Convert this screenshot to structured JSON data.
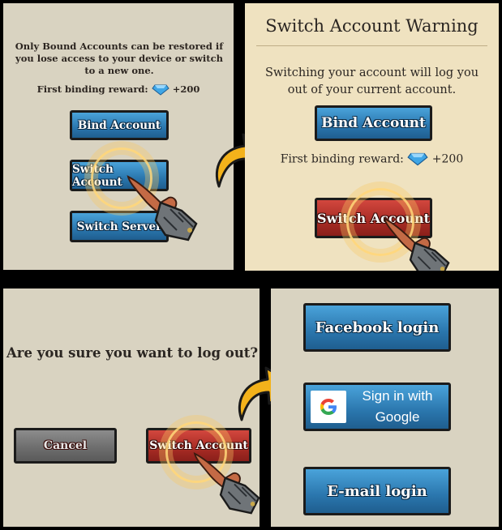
{
  "panel1": {
    "info_text": "Only Bound Accounts can be restored if you lose access to your device or switch to a new one.",
    "reward_label": "First binding reward:",
    "reward_amount": "+200",
    "bind_button": "Bind Account",
    "switch_account_button": "Switch Account",
    "switch_server_button": "Switch Server"
  },
  "panel2": {
    "title": "Switch Account Warning",
    "message": "Switching your account will log you out of your current account.",
    "bind_button": "Bind Account",
    "reward_label": "First binding reward:",
    "reward_amount": "+200",
    "switch_account_button": "Switch Account"
  },
  "panel3": {
    "question": "Are you sure you want to log out?",
    "cancel_button": "Cancel",
    "switch_account_button": "Switch Account"
  },
  "panel4": {
    "facebook_button": "Facebook login",
    "google_button_line1": "Sign in with",
    "google_button_line2": "Google",
    "email_button": "E-mail login"
  },
  "icons": {
    "gem": "gem-icon",
    "google": "google-g-icon",
    "hand": "pointing-gauntlet-icon",
    "arrow": "curved-arrow-icon"
  },
  "colors": {
    "button_blue": "#2a76ad",
    "button_red": "#a72b24",
    "button_gray": "#6c6c6c",
    "arrow_yellow": "#f3b21b",
    "ring_gold": "#ffd678",
    "panel_bg_gray": "#d9d3c1",
    "panel_bg_warm": "#efe2c0"
  }
}
